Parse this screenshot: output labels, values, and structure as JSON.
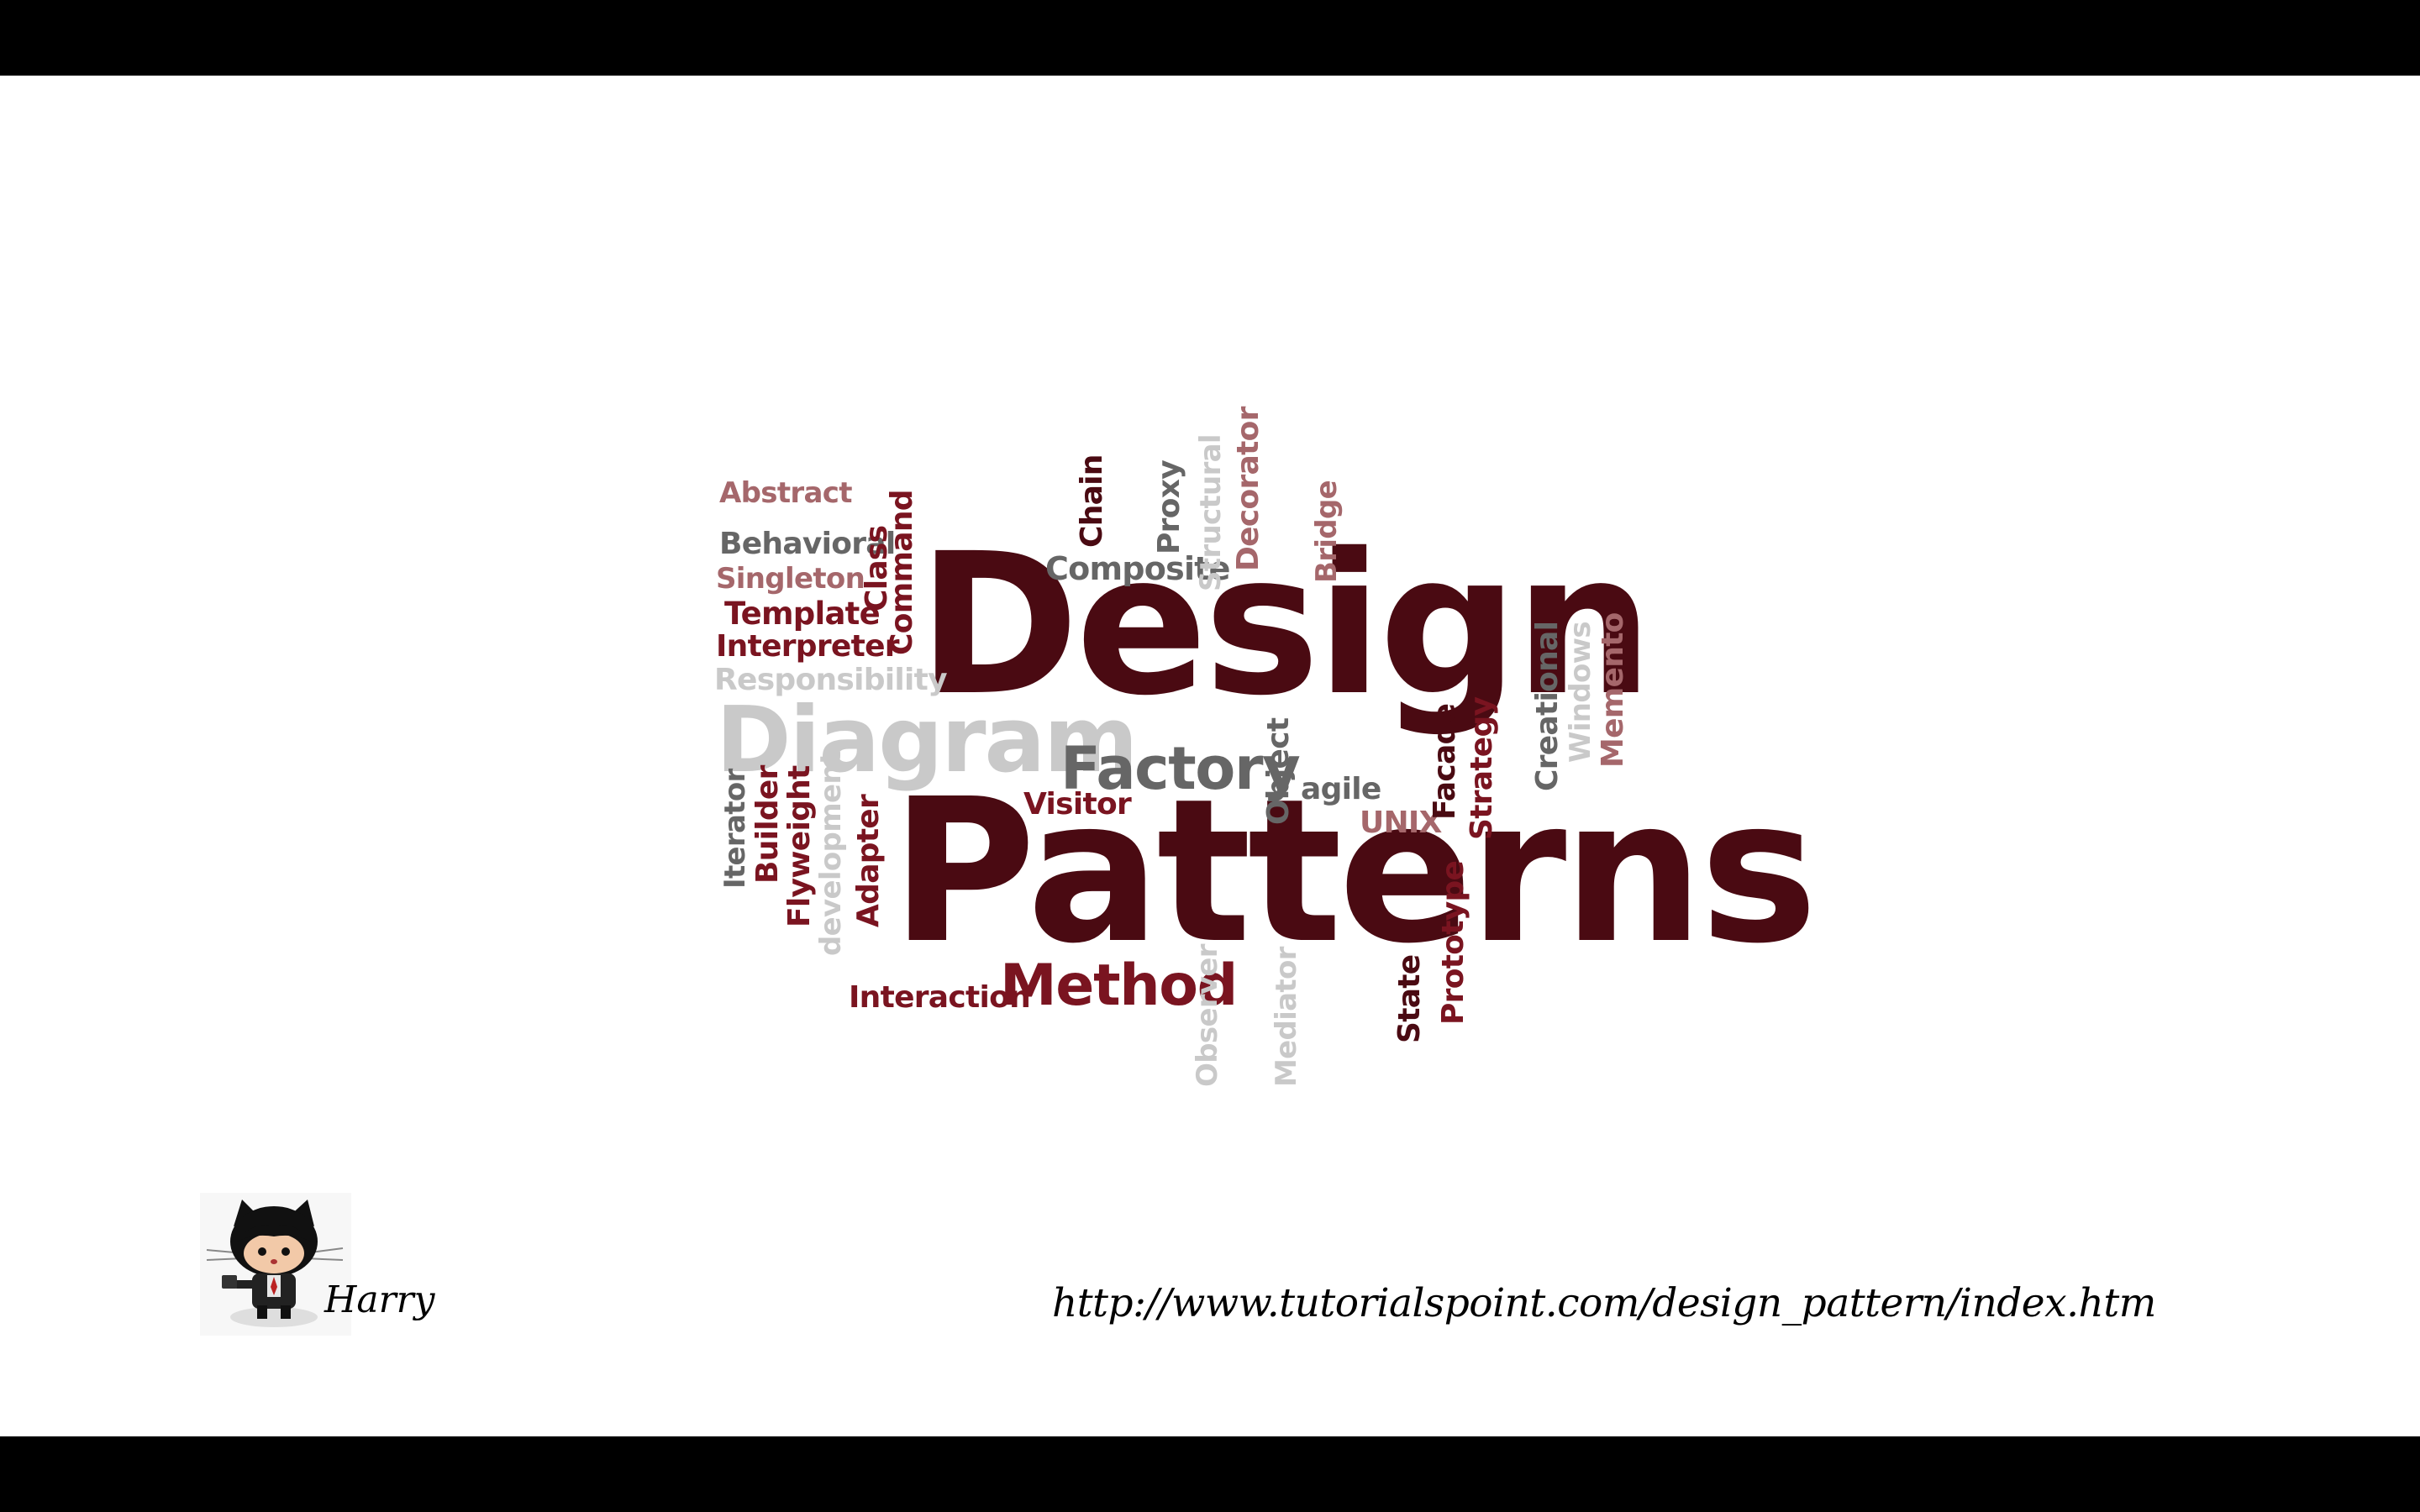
{
  "slide": {
    "author": "Harry",
    "url": "http://www.tutorialspoint.com/design_pattern/index.htm",
    "avatar_icon": "octocat-icon"
  },
  "wordcloud": {
    "colors": {
      "dark": "#4a0a12",
      "red": "#7a1420",
      "rose": "#a5676b",
      "gray": "#666666",
      "light": "#c9c9c9"
    },
    "words": [
      {
        "id": "design",
        "text": "Design",
        "color": "dark",
        "rotate": 0
      },
      {
        "id": "patterns",
        "text": "Patterns",
        "color": "dark",
        "rotate": 0
      },
      {
        "id": "diagram",
        "text": "Diagram",
        "color": "light",
        "rotate": 0
      },
      {
        "id": "factory",
        "text": "Factory",
        "color": "gray",
        "rotate": 0
      },
      {
        "id": "method",
        "text": "Method",
        "color": "red",
        "rotate": 0
      },
      {
        "id": "abstract",
        "text": "Abstract",
        "color": "rose",
        "rotate": 0
      },
      {
        "id": "behavioral",
        "text": "Behavioral",
        "color": "gray",
        "rotate": 0
      },
      {
        "id": "singleton",
        "text": "Singleton",
        "color": "rose",
        "rotate": 0
      },
      {
        "id": "template",
        "text": "Template",
        "color": "red",
        "rotate": 0
      },
      {
        "id": "interpreter",
        "text": "Interpreter",
        "color": "red",
        "rotate": 0
      },
      {
        "id": "responsibility",
        "text": "Responsibility",
        "color": "light",
        "rotate": 0
      },
      {
        "id": "class",
        "text": "Class",
        "color": "red",
        "rotate": -90
      },
      {
        "id": "command",
        "text": "Command",
        "color": "red",
        "rotate": -90
      },
      {
        "id": "composite",
        "text": "Composite",
        "color": "gray",
        "rotate": 0
      },
      {
        "id": "chain",
        "text": "Chain",
        "color": "dark",
        "rotate": -90
      },
      {
        "id": "proxy",
        "text": "Proxy",
        "color": "gray",
        "rotate": -90
      },
      {
        "id": "structural",
        "text": "Structural",
        "color": "light",
        "rotate": -90
      },
      {
        "id": "decorator",
        "text": "Decorator",
        "color": "rose",
        "rotate": -90
      },
      {
        "id": "bridge",
        "text": "Bridge",
        "color": "rose",
        "rotate": -90
      },
      {
        "id": "visitor",
        "text": "Visitor",
        "color": "red",
        "rotate": 0
      },
      {
        "id": "object",
        "text": "Object",
        "color": "gray",
        "rotate": -90
      },
      {
        "id": "agile",
        "text": "agile",
        "color": "gray",
        "rotate": 0
      },
      {
        "id": "unix",
        "text": "UNIX",
        "color": "rose",
        "rotate": 0
      },
      {
        "id": "facade",
        "text": "Facade",
        "color": "dark",
        "rotate": -90
      },
      {
        "id": "strategy",
        "text": "Strategy",
        "color": "red",
        "rotate": -90
      },
      {
        "id": "creational",
        "text": "Creational",
        "color": "gray",
        "rotate": -90
      },
      {
        "id": "windows",
        "text": "Windows",
        "color": "light",
        "rotate": -90
      },
      {
        "id": "memento",
        "text": "Memento",
        "color": "rose",
        "rotate": -90
      },
      {
        "id": "iterator",
        "text": "Iterator",
        "color": "gray",
        "rotate": -90
      },
      {
        "id": "builder",
        "text": "Builder",
        "color": "red",
        "rotate": -90
      },
      {
        "id": "flyweight",
        "text": "Flyweight",
        "color": "red",
        "rotate": -90
      },
      {
        "id": "development",
        "text": "development",
        "color": "light",
        "rotate": -90
      },
      {
        "id": "adapter",
        "text": "Adapter",
        "color": "red",
        "rotate": -90
      },
      {
        "id": "interaction",
        "text": "Interaction",
        "color": "red",
        "rotate": 0
      },
      {
        "id": "observer",
        "text": "Observer",
        "color": "light",
        "rotate": -90
      },
      {
        "id": "mediator",
        "text": "Mediator",
        "color": "light",
        "rotate": -90
      },
      {
        "id": "state",
        "text": "State",
        "color": "dark",
        "rotate": -90
      },
      {
        "id": "prototype",
        "text": "Prototype",
        "color": "red",
        "rotate": -90
      }
    ]
  }
}
